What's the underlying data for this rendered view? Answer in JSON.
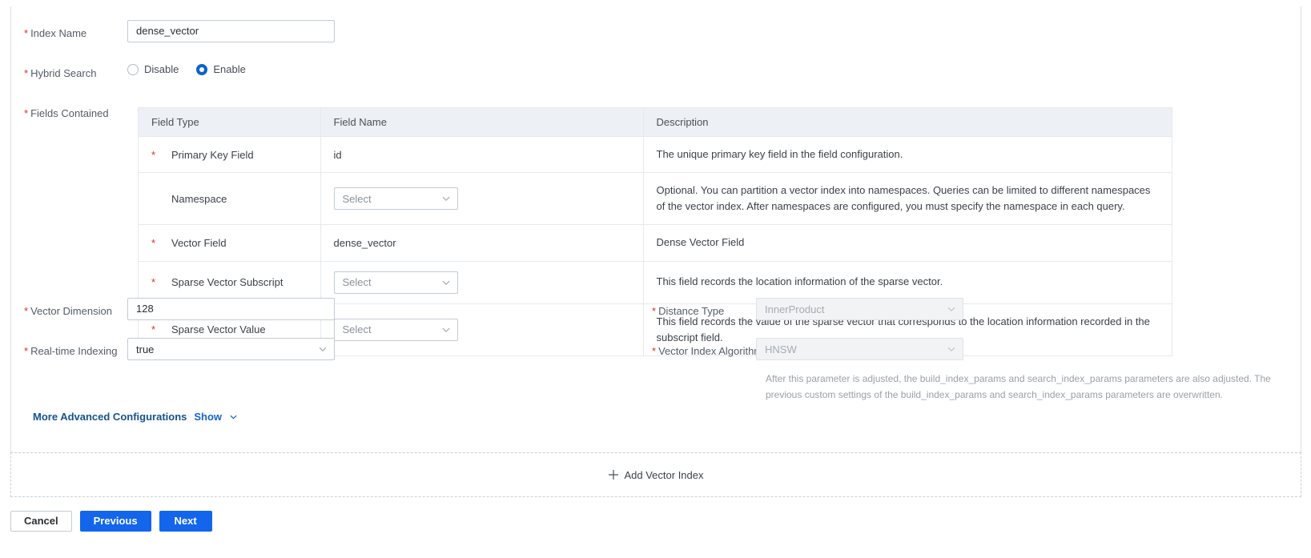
{
  "form": {
    "index_name": {
      "label": "Index Name",
      "required": true,
      "value": "dense_vector"
    },
    "hybrid_search": {
      "label": "Hybrid Search",
      "required": true,
      "options": [
        "Disable",
        "Enable"
      ],
      "selected": "Enable"
    },
    "fields_contained": {
      "label": "Fields Contained",
      "required": true,
      "columns": [
        "Field Type",
        "Field Name",
        "Description"
      ],
      "rows": [
        {
          "required": true,
          "field_type": "Primary Key Field",
          "field_name_kind": "text",
          "field_name": "id",
          "description": "The unique primary key field in the field configuration."
        },
        {
          "required": false,
          "field_type": "Namespace",
          "field_name_kind": "select",
          "field_name": "Select",
          "description": "Optional. You can partition a vector index into namespaces. Queries can be limited to different namespaces of the vector index. After namespaces are configured, you must specify the namespace in each query."
        },
        {
          "required": true,
          "field_type": "Vector Field",
          "field_name_kind": "text",
          "field_name": "dense_vector",
          "description": "Dense Vector Field"
        },
        {
          "required": true,
          "field_type": "Sparse Vector Subscript",
          "field_name_kind": "select",
          "field_name": "Select",
          "description": "This field records the location information of the sparse vector."
        },
        {
          "required": true,
          "field_type": "Sparse Vector Value",
          "field_name_kind": "select",
          "field_name": "Select",
          "description": "This field records the value of the sparse vector that corresponds to the location information recorded in the subscript field."
        }
      ]
    },
    "vector_dimension": {
      "label": "Vector Dimension",
      "required": true,
      "value": "128"
    },
    "distance_type": {
      "label": "Distance Type",
      "required": true,
      "value": "InnerProduct",
      "disabled": true
    },
    "realtime_indexing": {
      "label": "Real-time Indexing",
      "required": true,
      "value": "true",
      "disabled": false
    },
    "vector_index_algorithm": {
      "label": "Vector Index Algorithm",
      "required": true,
      "value": "HNSW",
      "disabled": true,
      "helper_text": "After this parameter is adjusted, the build_index_params and search_index_params parameters are also adjusted. The previous custom settings of the build_index_params and search_index_params parameters are overwritten."
    },
    "advanced": {
      "title": "More Advanced Configurations",
      "toggle_label": "Show"
    }
  },
  "add_vector_index": {
    "label": "Add Vector Index"
  },
  "footer": {
    "cancel": "Cancel",
    "previous": "Previous",
    "next": "Next"
  },
  "colors": {
    "primary": "#1366EC",
    "required_star": "#D93026",
    "link": "#1565C7",
    "table_header_bg": "#EDF0F4"
  }
}
